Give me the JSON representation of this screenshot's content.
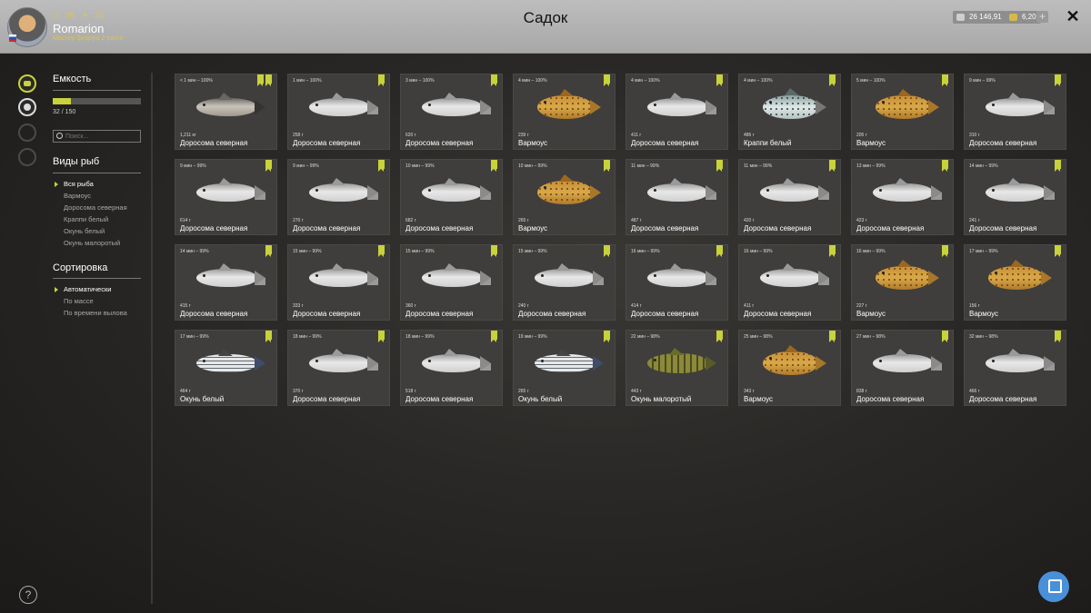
{
  "header": {
    "title": "Садок",
    "user": {
      "name": "Romarion",
      "rank": "Мастер фидера 2 ранга",
      "stat1": "38",
      "stat2": "33"
    },
    "currency": {
      "money": "26 146,91",
      "gold": "6,20"
    },
    "plus": "+",
    "close": "✕"
  },
  "sidebar": {
    "capacity": {
      "title": "Емкость",
      "text": "32 / 150",
      "fill": 0.21
    },
    "search_placeholder": "Поиск...",
    "species": {
      "title": "Виды рыб",
      "items": [
        "Вся рыба",
        "Вармоус",
        "Доросома северная",
        "Краппи белый",
        "Окунь белый",
        "Окунь малоротый"
      ],
      "active": 0
    },
    "sort": {
      "title": "Сортировка",
      "items": [
        "Автоматически",
        "По массе",
        "По времени вылова"
      ],
      "active": 0
    },
    "help": "?"
  },
  "fish_icons": {
    "shad": "gizzard-shad-icon",
    "warmouth": "warmouth-icon",
    "crappie": "white-crappie-icon",
    "white_bass": "white-bass-icon",
    "smallmouth": "smallmouth-bass-icon"
  },
  "colors": {
    "accent": "#c8d23a",
    "button_blue": "#4a90d9"
  },
  "cards": [
    {
      "time": "< 1 мин – 100%",
      "weight": "1,211 кг",
      "name": "Доросома северная",
      "kind": "dark-silver",
      "flags": 2
    },
    {
      "time": "1 мин – 100%",
      "weight": "258 г",
      "name": "Доросома северная",
      "kind": "silver",
      "flags": 1
    },
    {
      "time": "3 мин – 100%",
      "weight": "620 г",
      "name": "Доросома северная",
      "kind": "silver",
      "flags": 1
    },
    {
      "time": "4 мин – 100%",
      "weight": "239 г",
      "name": "Вармоус",
      "kind": "golden",
      "flags": 1
    },
    {
      "time": "4 мин – 100%",
      "weight": "411 г",
      "name": "Доросома северная",
      "kind": "silver",
      "flags": 1
    },
    {
      "time": "4 мин – 100%",
      "weight": "486 г",
      "name": "Краппи белый",
      "kind": "crappie",
      "flags": 1
    },
    {
      "time": "5 мин – 100%",
      "weight": "205 г",
      "name": "Вармоус",
      "kind": "golden",
      "flags": 1
    },
    {
      "time": "9 мин – 99%",
      "weight": "310 г",
      "name": "Доросома северная",
      "kind": "silver",
      "flags": 1
    },
    {
      "time": "9 мин – 99%",
      "weight": "614 г",
      "name": "Доросома северная",
      "kind": "silver",
      "flags": 1
    },
    {
      "time": "9 мин – 99%",
      "weight": "270 г",
      "name": "Доросома северная",
      "kind": "silver",
      "flags": 1
    },
    {
      "time": "10 мин – 99%",
      "weight": "682 г",
      "name": "Доросома северная",
      "kind": "silver",
      "flags": 1
    },
    {
      "time": "10 мин – 99%",
      "weight": "265 г",
      "name": "Вармоус",
      "kind": "golden",
      "flags": 1
    },
    {
      "time": "11 мин – 99%",
      "weight": "487 г",
      "name": "Доросома северная",
      "kind": "silver",
      "flags": 1
    },
    {
      "time": "11 мин – 99%",
      "weight": "420 г",
      "name": "Доросома северная",
      "kind": "silver",
      "flags": 1
    },
    {
      "time": "13 мин – 99%",
      "weight": "423 г",
      "name": "Доросома северная",
      "kind": "silver",
      "flags": 1
    },
    {
      "time": "14 мин – 99%",
      "weight": "241 г",
      "name": "Доросома северная",
      "kind": "silver",
      "flags": 1
    },
    {
      "time": "14 мин – 99%",
      "weight": "415 г",
      "name": "Доросома северная",
      "kind": "silver",
      "flags": 1
    },
    {
      "time": "15 мин – 99%",
      "weight": "333 г",
      "name": "Доросома северная",
      "kind": "silver",
      "flags": 1
    },
    {
      "time": "15 мин – 99%",
      "weight": "360 г",
      "name": "Доросома северная",
      "kind": "silver",
      "flags": 1
    },
    {
      "time": "15 мин – 99%",
      "weight": "240 г",
      "name": "Доросома северная",
      "kind": "silver",
      "flags": 1
    },
    {
      "time": "16 мин – 99%",
      "weight": "414 г",
      "name": "Доросома северная",
      "kind": "silver",
      "flags": 1
    },
    {
      "time": "16 мин – 99%",
      "weight": "411 г",
      "name": "Доросома северная",
      "kind": "silver",
      "flags": 1
    },
    {
      "time": "16 мин – 99%",
      "weight": "227 г",
      "name": "Вармоус",
      "kind": "golden",
      "flags": 1
    },
    {
      "time": "17 мин – 99%",
      "weight": "156 г",
      "name": "Вармоус",
      "kind": "golden",
      "flags": 1
    },
    {
      "time": "17 мин – 99%",
      "weight": "464 г",
      "name": "Окунь белый",
      "kind": "bass-white",
      "flags": 1
    },
    {
      "time": "18 мин – 99%",
      "weight": "370 г",
      "name": "Доросома северная",
      "kind": "silver",
      "flags": 1
    },
    {
      "time": "18 мин – 99%",
      "weight": "518 г",
      "name": "Доросома северная",
      "kind": "silver",
      "flags": 1
    },
    {
      "time": "19 мин – 99%",
      "weight": "265 г",
      "name": "Окунь белый",
      "kind": "bass-white",
      "flags": 1
    },
    {
      "time": "22 мин – 98%",
      "weight": "443 г",
      "name": "Окунь малоротый",
      "kind": "bass-small",
      "flags": 1
    },
    {
      "time": "25 мин – 98%",
      "weight": "343 г",
      "name": "Вармоус",
      "kind": "golden",
      "flags": 1
    },
    {
      "time": "27 мин – 98%",
      "weight": "838 г",
      "name": "Доросома северная",
      "kind": "silver",
      "flags": 1
    },
    {
      "time": "32 мин – 98%",
      "weight": "466 г",
      "name": "Доросома северная",
      "kind": "silver",
      "flags": 1
    }
  ]
}
